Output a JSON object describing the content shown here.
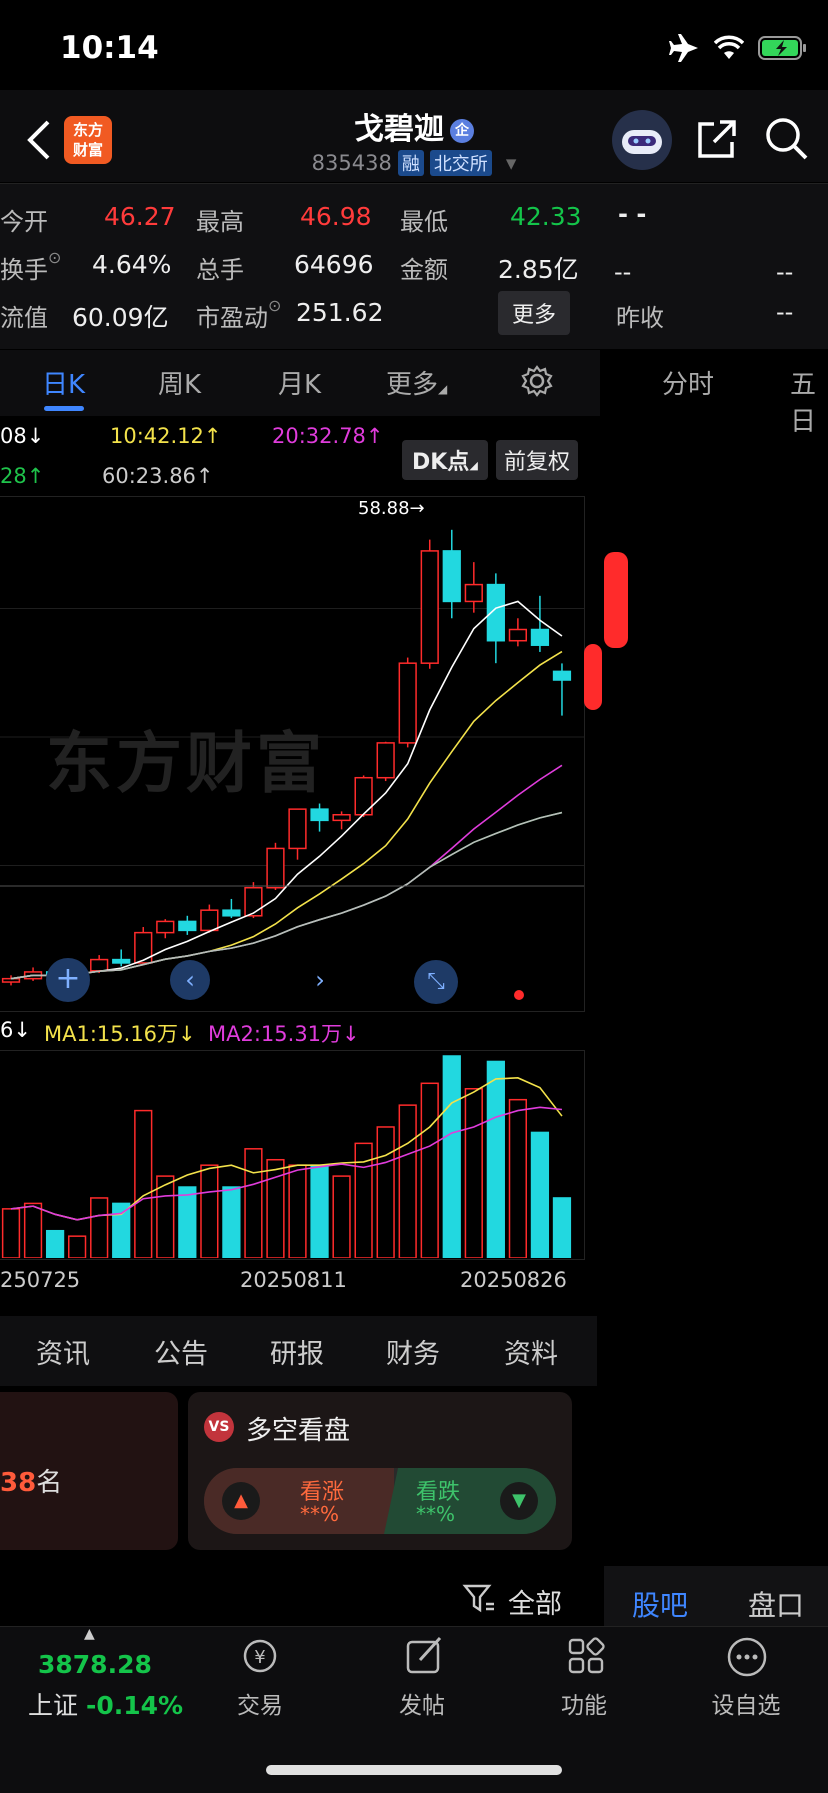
{
  "status_bar": {
    "time": "10:14"
  },
  "header": {
    "app_logo": "东方\n财富",
    "stock_name": "戈碧迦",
    "qi_badge": "企",
    "stock_code": "835438",
    "tag_margin": "融",
    "tag_exchange": "北交所"
  },
  "stats": {
    "row1": [
      {
        "label": "今开",
        "value": "46.27"
      },
      {
        "label": "最高",
        "value": "46.98"
      },
      {
        "label": "最低",
        "value": "42.33"
      }
    ],
    "row2": [
      {
        "label": "换手",
        "value": "4.64%"
      },
      {
        "label": "总手",
        "value": "64696"
      },
      {
        "label": "金额",
        "value": "2.85亿"
      }
    ],
    "row3": [
      {
        "label": "流值",
        "value": "60.09亿"
      },
      {
        "label": "市盈动",
        "value": "251.62"
      }
    ],
    "more_button": "更多",
    "right_panel": {
      "top": "- -",
      "r2a": "--",
      "r2b": "--",
      "r3_label": "昨收",
      "r3_value": "--"
    }
  },
  "tabs": {
    "day": "日K",
    "week": "周K",
    "month": "月K",
    "more": "更多",
    "time_share": "分时",
    "five": "五日"
  },
  "ma_legend": {
    "row1a": "08↓",
    "row1b": "10:42.12↑",
    "row1c": "20:32.78↑",
    "row2a": "28↑",
    "row2b": "60:23.86↑",
    "dk_button": "DK点",
    "adjust_button": "前复权"
  },
  "chart": {
    "high_label": "58.88→",
    "watermark": "东方财富",
    "vol_legend_a": "6↓",
    "vol_legend_b": "MA1:15.16万↓",
    "vol_legend_c": "MA2:15.31万↓",
    "dates": [
      "250725",
      "20250811",
      "20250826"
    ]
  },
  "chart_data": {
    "type": "candlestick",
    "candles": [
      {
        "o": 18.6,
        "h": 19.2,
        "l": 18.3,
        "c": 18.9,
        "v": 9
      },
      {
        "o": 18.9,
        "h": 19.9,
        "l": 18.7,
        "c": 19.5,
        "v": 10
      },
      {
        "o": 19.5,
        "h": 20.3,
        "l": 19.0,
        "c": 19.2,
        "v": 5
      },
      {
        "o": 19.2,
        "h": 20.0,
        "l": 18.8,
        "c": 19.6,
        "v": 4
      },
      {
        "o": 19.6,
        "h": 21.0,
        "l": 19.4,
        "c": 20.6,
        "v": 11
      },
      {
        "o": 20.6,
        "h": 21.5,
        "l": 20.0,
        "c": 20.3,
        "v": 10
      },
      {
        "o": 20.3,
        "h": 23.5,
        "l": 20.1,
        "c": 23.0,
        "v": 27
      },
      {
        "o": 23.0,
        "h": 24.2,
        "l": 22.5,
        "c": 24.0,
        "v": 15
      },
      {
        "o": 24.0,
        "h": 24.5,
        "l": 22.8,
        "c": 23.2,
        "v": 13
      },
      {
        "o": 23.2,
        "h": 25.5,
        "l": 23.0,
        "c": 25.0,
        "v": 17
      },
      {
        "o": 25.0,
        "h": 26.0,
        "l": 24.3,
        "c": 24.5,
        "v": 13
      },
      {
        "o": 24.5,
        "h": 27.5,
        "l": 24.3,
        "c": 27.0,
        "v": 20
      },
      {
        "o": 27.0,
        "h": 31.0,
        "l": 26.8,
        "c": 30.5,
        "v": 18
      },
      {
        "o": 30.5,
        "h": 34.0,
        "l": 29.5,
        "c": 34.0,
        "v": 17
      },
      {
        "o": 34.0,
        "h": 34.5,
        "l": 32.0,
        "c": 33.0,
        "v": 17
      },
      {
        "o": 33.0,
        "h": 33.8,
        "l": 32.2,
        "c": 33.5,
        "v": 15
      },
      {
        "o": 33.5,
        "h": 37.0,
        "l": 33.3,
        "c": 36.8,
        "v": 21
      },
      {
        "o": 36.8,
        "h": 40.0,
        "l": 36.5,
        "c": 39.9,
        "v": 24
      },
      {
        "o": 39.9,
        "h": 47.5,
        "l": 39.5,
        "c": 47.0,
        "v": 28
      },
      {
        "o": 47.0,
        "h": 58.0,
        "l": 46.5,
        "c": 57.0,
        "v": 32
      },
      {
        "o": 57.0,
        "h": 58.88,
        "l": 51.0,
        "c": 52.5,
        "v": 37
      },
      {
        "o": 52.5,
        "h": 56.0,
        "l": 51.5,
        "c": 54.0,
        "v": 31
      },
      {
        "o": 54.0,
        "h": 55.0,
        "l": 47.0,
        "c": 49.0,
        "v": 36
      },
      {
        "o": 49.0,
        "h": 51.0,
        "l": 48.5,
        "c": 50.0,
        "v": 29
      },
      {
        "o": 50.0,
        "h": 53.0,
        "l": 48.0,
        "c": 48.6,
        "v": 23
      },
      {
        "o": 46.27,
        "h": 46.98,
        "l": 42.33,
        "c": 45.5,
        "v": 11
      }
    ],
    "ylim": [
      17,
      61
    ],
    "dates": [
      "250725",
      "20250811",
      "20250826"
    ]
  },
  "news_tabs": [
    "资讯",
    "公告",
    "研报",
    "财务",
    "资料"
  ],
  "cards": {
    "rank_text": "38",
    "rank_suffix": "名",
    "vs_title": "多空看盘",
    "bull_label": "看涨",
    "bull_value": "**%",
    "bear_label": "看跌",
    "bear_value": "**%"
  },
  "filter": {
    "label": "全部"
  },
  "side_tabs": {
    "guba": "股吧",
    "pankou": "盘口"
  },
  "index": {
    "value": "3878.28",
    "name": "上证",
    "change": "-0.14%"
  },
  "bottom_nav": {
    "trade": "交易",
    "post": "发帖",
    "func": "功能",
    "watch": "设自选"
  }
}
